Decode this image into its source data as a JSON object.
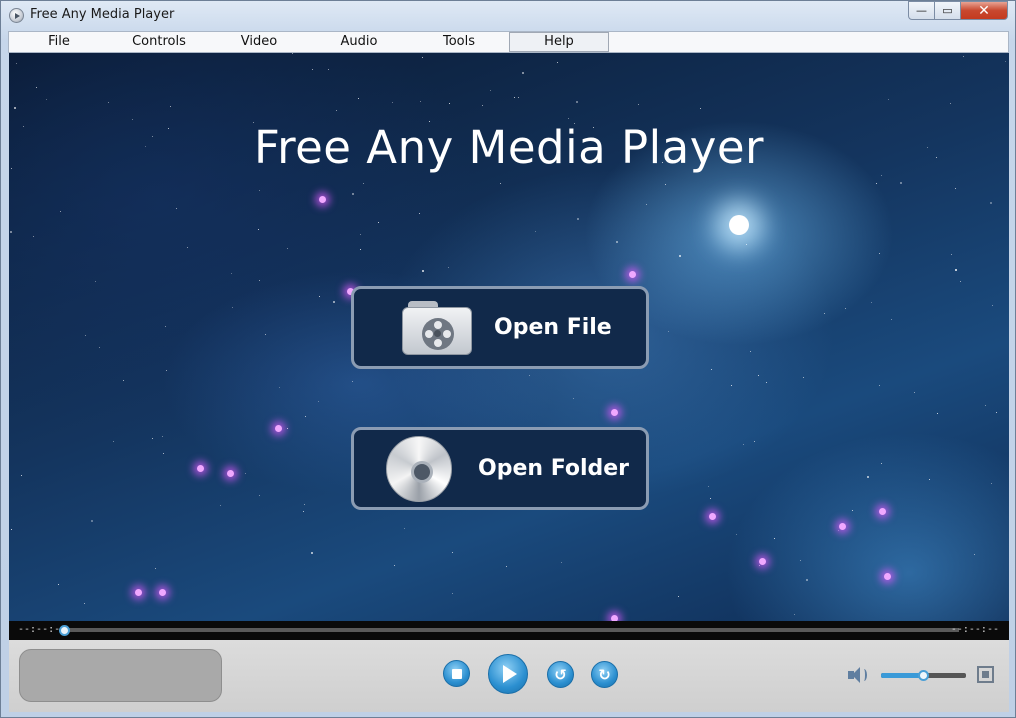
{
  "window": {
    "title": "Free Any Media Player"
  },
  "window_controls": {
    "minimize": "—",
    "maximize": "▭",
    "close": "✕"
  },
  "menu": {
    "items": [
      "File",
      "Controls",
      "Video",
      "Audio",
      "Tools",
      "Help"
    ],
    "active": "Help"
  },
  "hero": {
    "title": "Free Any Media Player"
  },
  "buttons": {
    "open_file": "Open File",
    "open_folder": "Open Folder"
  },
  "seek": {
    "elapsed": "--:--:--",
    "remaining": "--:--:--",
    "progress": 0
  },
  "playback": {
    "back_glyph": "↺",
    "forward_glyph": "↻"
  },
  "volume": {
    "level": 0.5
  },
  "colors": {
    "accent": "#2b8fd0",
    "button_bg": "#11294a",
    "button_border": "#8b9cb3"
  },
  "icons": [
    "app-icon",
    "film-reel-folder-icon",
    "disc-icon",
    "stop-icon",
    "play-icon",
    "rewind-icon",
    "forward-icon",
    "volume-icon",
    "fullscreen-icon"
  ]
}
